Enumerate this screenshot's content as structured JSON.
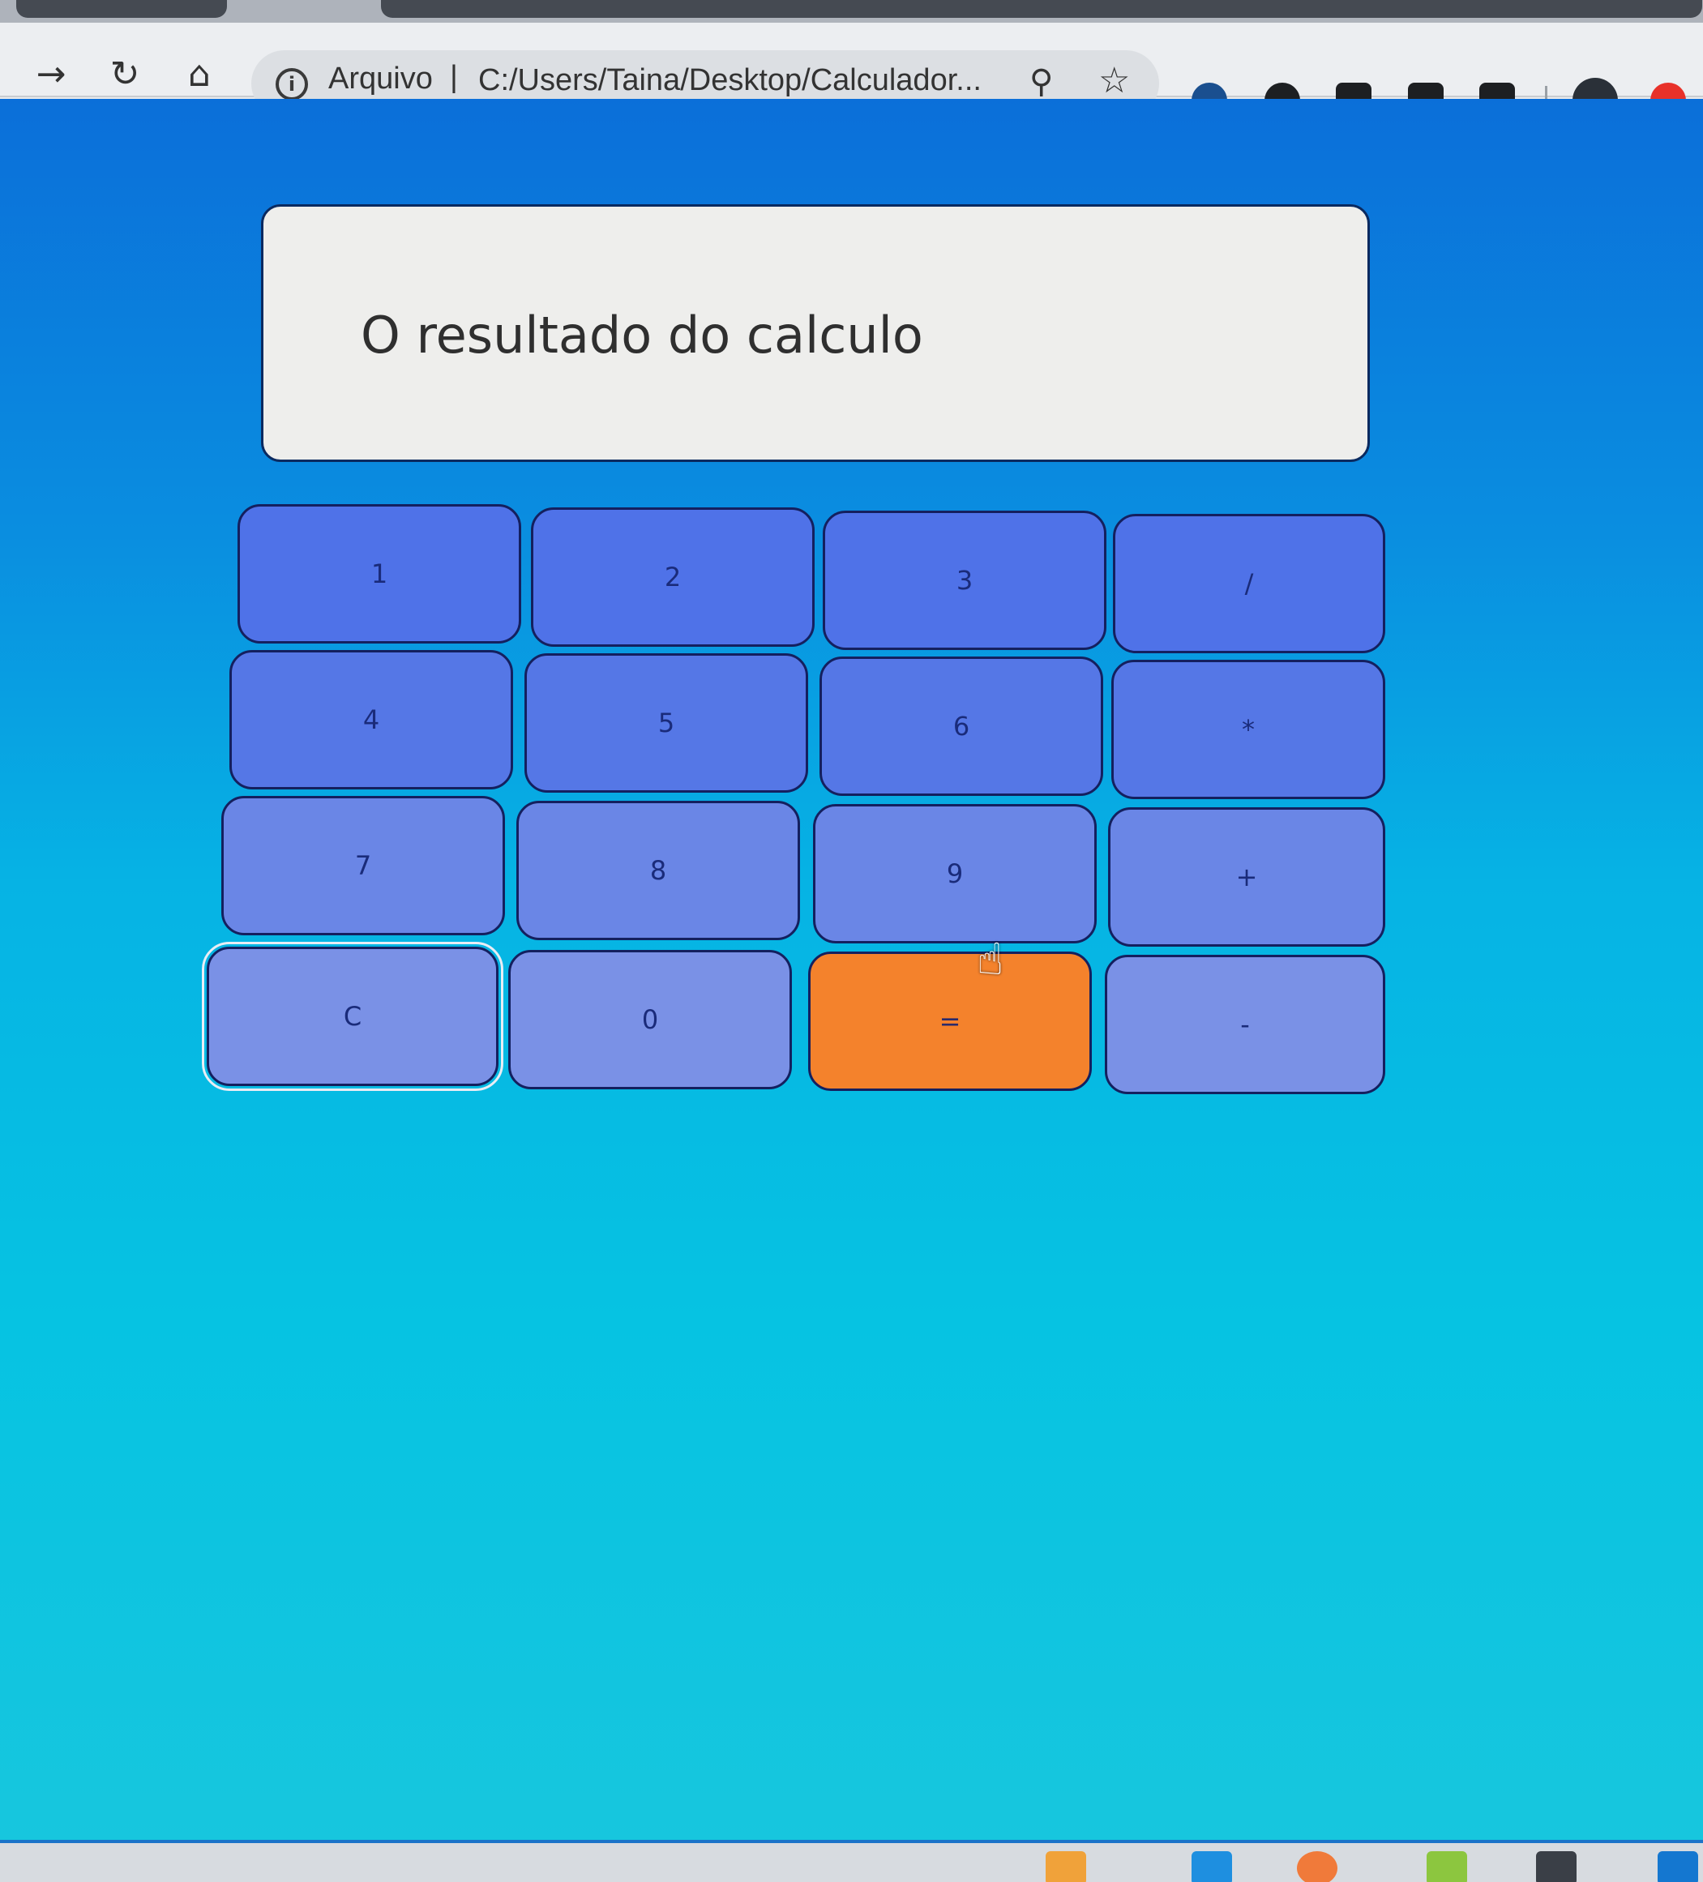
{
  "browser": {
    "omnibox": {
      "security_label": "Arquivo",
      "separator": "|",
      "url": "C:/Users/Taina/Desktop/Calculador..."
    },
    "icons": {
      "forward": "forward-arrow-icon",
      "reload": "reload-icon",
      "home": "home-icon",
      "info": "info-icon",
      "zoom": "zoom-icon",
      "bookmark": "star-icon"
    }
  },
  "calculator": {
    "display_text": "O resultado do calculo",
    "keys": [
      {
        "label": "1"
      },
      {
        "label": "2"
      },
      {
        "label": "3"
      },
      {
        "label": "/"
      },
      {
        "label": "4"
      },
      {
        "label": "5"
      },
      {
        "label": "6"
      },
      {
        "label": "*"
      },
      {
        "label": "7"
      },
      {
        "label": "8"
      },
      {
        "label": "9"
      },
      {
        "label": "+"
      },
      {
        "label": "C"
      },
      {
        "label": "0"
      },
      {
        "label": "="
      },
      {
        "label": "-"
      }
    ]
  },
  "colors": {
    "equals_key": "#f4822c",
    "keys": "#5577e6",
    "background_top": "#0b6fd9",
    "background_bottom": "#17c6de"
  }
}
